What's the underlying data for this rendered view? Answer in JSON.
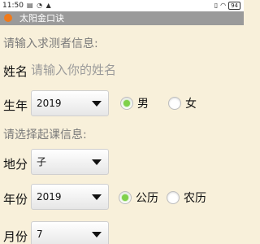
{
  "status_bar": {
    "time": "11:50",
    "left_icons": "▤ ◔ ▲",
    "battery": "94"
  },
  "app": {
    "title": "太阳金口诀"
  },
  "form": {
    "section1_label": "请输入求测者信息:",
    "name_label": "姓名",
    "name_placeholder": "请输入你的姓名",
    "name_value": "",
    "birth_year_label": "生年",
    "birth_year_value": "2019",
    "gender": {
      "male_label": "男",
      "female_label": "女",
      "selected": "男"
    },
    "section2_label": "请选择起课信息:",
    "difen_label": "地分",
    "difen_value": "子",
    "year_label": "年份",
    "year_value": "2019",
    "calendar": {
      "solar_label": "公历",
      "lunar_label": "农历",
      "selected": "公历"
    },
    "month_label": "月份",
    "month_value": "7"
  }
}
